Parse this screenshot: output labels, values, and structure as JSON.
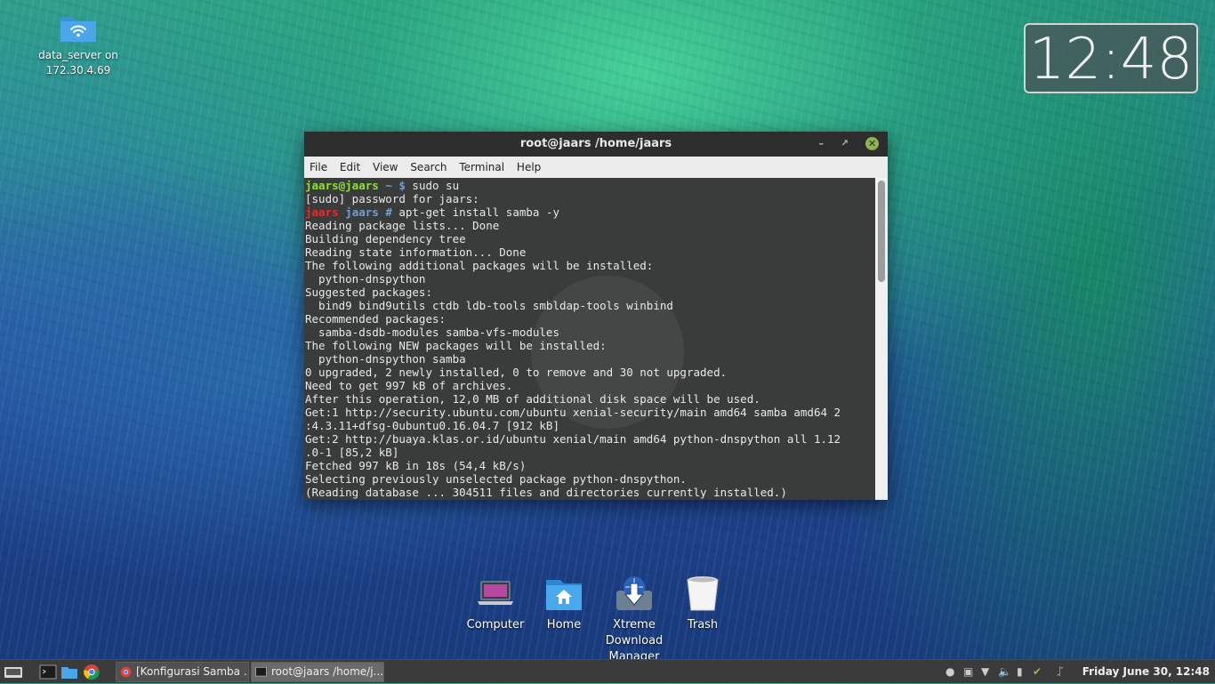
{
  "desktop": {
    "icon_label_line1": "data_server on",
    "icon_label_line2": "172.30.4.69"
  },
  "clock": {
    "time": "12:48"
  },
  "terminal": {
    "title": "root@jaars /home/jaars",
    "menu": [
      "File",
      "Edit",
      "View",
      "Search",
      "Terminal",
      "Help"
    ],
    "lines": [
      {
        "user": "jaars@jaars",
        "path": "~ $",
        "cmd": " sudo su"
      },
      {
        "text": "[sudo] password for jaars:"
      },
      {
        "user_red": "jaars",
        "path": "jaars #",
        "cmd": " apt-get install samba -y"
      },
      {
        "text": "Reading package lists... Done"
      },
      {
        "text": "Building dependency tree"
      },
      {
        "text": "Reading state information... Done"
      },
      {
        "text": "The following additional packages will be installed:"
      },
      {
        "text": "  python-dnspython"
      },
      {
        "text": "Suggested packages:"
      },
      {
        "text": "  bind9 bind9utils ctdb ldb-tools smbldap-tools winbind"
      },
      {
        "text": "Recommended packages:"
      },
      {
        "text": "  samba-dsdb-modules samba-vfs-modules"
      },
      {
        "text": "The following NEW packages will be installed:"
      },
      {
        "text": "  python-dnspython samba"
      },
      {
        "text": "0 upgraded, 2 newly installed, 0 to remove and 30 not upgraded."
      },
      {
        "text": "Need to get 997 kB of archives."
      },
      {
        "text": "After this operation, 12,0 MB of additional disk space will be used."
      },
      {
        "text": "Get:1 http://security.ubuntu.com/ubuntu xenial-security/main amd64 samba amd64 2"
      },
      {
        "text": ":4.3.11+dfsg-0ubuntu0.16.04.7 [912 kB]"
      },
      {
        "text": "Get:2 http://buaya.klas.or.id/ubuntu xenial/main amd64 python-dnspython all 1.12"
      },
      {
        "text": ".0-1 [85,2 kB]"
      },
      {
        "text": "Fetched 997 kB in 18s (54,4 kB/s)"
      },
      {
        "text": "Selecting previously unselected package python-dnspython."
      },
      {
        "text": "(Reading database ... 304511 files and directories currently installed.)"
      }
    ]
  },
  "dock": {
    "computer": "Computer",
    "home": "Home",
    "xdm_line1": "Xtreme Download",
    "xdm_line2": "Manager",
    "trash": "Trash"
  },
  "taskbar": {
    "task1": "[Konfigurasi Samba ...",
    "task2": "root@jaars /home/j...",
    "datetime": "Friday June 30, 12:48"
  }
}
